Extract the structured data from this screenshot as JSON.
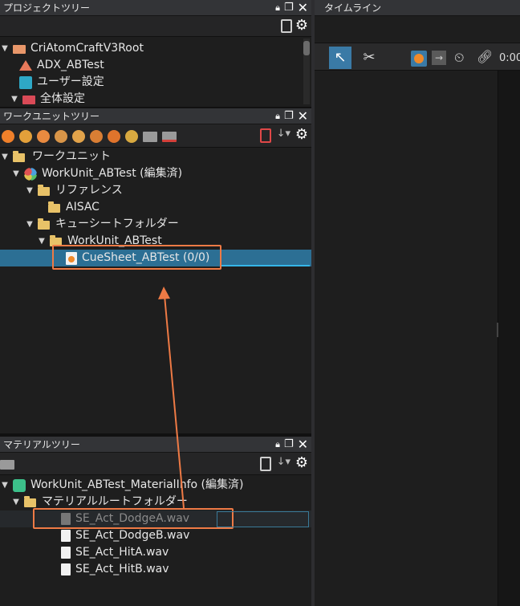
{
  "project_tree": {
    "title": "プロジェクトツリー",
    "items": [
      {
        "label": "CriAtomCraftV3Root"
      },
      {
        "label": "ADX_ABTest"
      },
      {
        "label": "ユーザー設定"
      },
      {
        "label": "全体設定"
      }
    ]
  },
  "timeline": {
    "title": "タイムライン",
    "time_label": "0:00"
  },
  "workunit_tree": {
    "title": "ワークユニットツリー",
    "items": [
      {
        "label": "ワークユニット"
      },
      {
        "label": "WorkUnit_ABTest (編集済)"
      },
      {
        "label": "リファレンス"
      },
      {
        "label": "AISAC"
      },
      {
        "label": "キューシートフォルダー"
      },
      {
        "label": "WorkUnit_ABTest"
      },
      {
        "label": "CueSheet_ABTest (0/0)"
      }
    ]
  },
  "material_tree": {
    "title": "マテリアルツリー",
    "items": [
      {
        "label": "WorkUnit_ABTest_MaterialInfo (編集済)"
      },
      {
        "label": "マテリアルルートフォルダー"
      },
      {
        "label": "SE_Act_DodgeA.wav"
      },
      {
        "label": "SE_Act_DodgeB.wav"
      },
      {
        "label": "SE_Act_HitA.wav"
      },
      {
        "label": "SE_Act_HitB.wav"
      }
    ]
  },
  "colors": {
    "accent": "#ee7a45",
    "selection": "#2c6f94",
    "folder": "#e8c268"
  }
}
